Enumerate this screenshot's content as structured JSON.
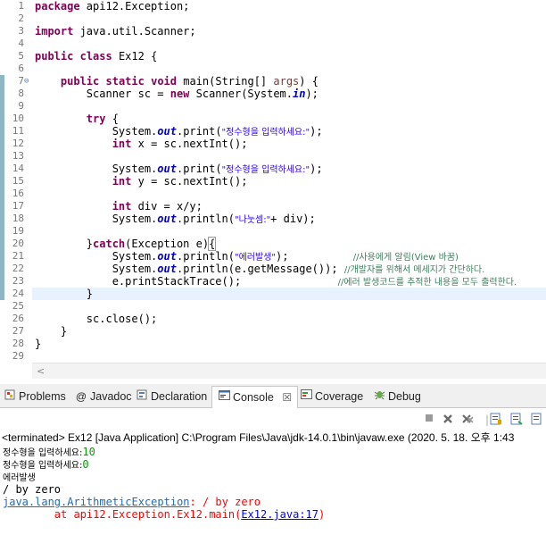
{
  "editor": {
    "line_numbers": [
      "1",
      "2",
      "3",
      "4",
      "5",
      "6",
      "7",
      "8",
      "9",
      "10",
      "11",
      "12",
      "13",
      "14",
      "15",
      "16",
      "17",
      "18",
      "19",
      "20",
      "21",
      "22",
      "23",
      "24",
      "25",
      "26",
      "27",
      "28",
      "29"
    ],
    "fold_marker": "⊖",
    "lines": {
      "l1": {
        "kw": "package",
        "rest": " api12.Exception;"
      },
      "l3": {
        "kw": "import",
        "rest": " java.util.Scanner;"
      },
      "l5": {
        "kw1": "public",
        "kw2": "class",
        "rest": " Ex12 {"
      },
      "l7": {
        "indent": "    ",
        "kw1": "public",
        "kw2": "static",
        "kw3": "void",
        "name": " main(String[] ",
        "param": "args",
        "end": ") {"
      },
      "l8": {
        "indent": "        ",
        "a": "Scanner sc = ",
        "kw": "new",
        "b": " Scanner(System.",
        "fld": "in",
        "end": ");"
      },
      "l10": {
        "indent": "        ",
        "kw": "try",
        "rest": " {"
      },
      "l11": {
        "indent": "            ",
        "a": "System.",
        "fld": "out",
        "b": ".print(",
        "str": "\"정수형을 입력하세요:\"",
        "end": ");"
      },
      "l12": {
        "indent": "            ",
        "kw": "int",
        "rest": " x = sc.nextInt();"
      },
      "l14": {
        "indent": "            ",
        "a": "System.",
        "fld": "out",
        "b": ".print(",
        "str": "\"정수형을 입력하세요:\"",
        "end": ");"
      },
      "l15": {
        "indent": "            ",
        "kw": "int",
        "rest": " y = sc.nextInt();"
      },
      "l17": {
        "indent": "            ",
        "kw": "int",
        "rest": " div = x/y;"
      },
      "l18": {
        "indent": "            ",
        "a": "System.",
        "fld": "out",
        "b": ".println(",
        "str": "\"나눗셈:\"",
        "end": "+ div);"
      },
      "l20": {
        "indent": "        ",
        "a": "}",
        "kw": "catch",
        "b": "(Exception e)",
        "brace": "{"
      },
      "l21": {
        "indent": "            ",
        "a": "System.",
        "fld": "out",
        "b": ".println(",
        "str": "\"에러발생\"",
        "end": ");",
        "gap": "          ",
        "cmt": "//사용에게 알림(View 바꿈)"
      },
      "l22": {
        "indent": "            ",
        "a": "System.",
        "fld": "out",
        "b": ".println(e.getMessage());",
        "gap": " ",
        "cmt": "//개발자를 위해서 메세지가 간단하다."
      },
      "l23": {
        "indent": "            ",
        "a": "e.printStackTrace();",
        "gap": "               ",
        "cmt": "//에러 발생코드를 추적한 내용을 모두 출력한다."
      },
      "l24": {
        "indent": "        ",
        "a": "}"
      },
      "l26": {
        "indent": "        ",
        "a": "sc.close();"
      },
      "l27": {
        "indent": "    ",
        "a": "}"
      },
      "l28": {
        "indent": "",
        "a": "}"
      }
    },
    "hscroll_arrow": "<"
  },
  "views": {
    "tabs": [
      {
        "label": "Problems",
        "icon": "problems-icon"
      },
      {
        "label": "Javadoc",
        "icon": "at-icon"
      },
      {
        "label": "Declaration",
        "icon": "declaration-icon"
      },
      {
        "label": "Console",
        "icon": "console-icon",
        "close": "☒"
      },
      {
        "label": "Coverage",
        "icon": "coverage-icon"
      },
      {
        "label": "Debug",
        "icon": "debug-icon"
      }
    ],
    "colors": {
      "changebar": "#8fb6c6",
      "current_line": "#e8f2fe",
      "keyword": "#7f0055",
      "string": "#2a00ff",
      "comment": "#3f7f5f",
      "error": "#ff0000",
      "input": "#00a000"
    }
  },
  "console": {
    "terminated": "<terminated> Ex12 [Java Application] C:\\Program Files\\Java\\jdk-14.0.1\\bin\\javaw.exe  (2020. 5. 18. 오후 1:43",
    "out1_prompt": "정수형을 입력하세요:",
    "out1_value": "10",
    "out2_prompt": "정수형을 입력하세요:",
    "out2_value": "0",
    "out3": "에러발생",
    "out4": "/ by zero",
    "exc_class": "java.lang.ArithmeticException",
    "exc_msg": ": / by zero",
    "trace_prefix": "        at api12.Exception.Ex12.main(",
    "trace_link": "Ex12.java:17",
    "trace_suffix": ")"
  }
}
